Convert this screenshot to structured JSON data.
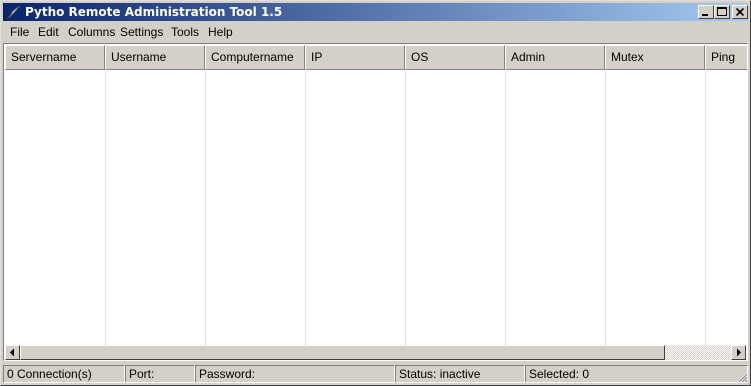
{
  "window": {
    "title": "Pytho Remote Administration Tool 1.5"
  },
  "menu": [
    "File",
    "Edit",
    "Columns",
    "Settings",
    "Tools",
    "Help"
  ],
  "columns": [
    "Servername",
    "Username",
    "Computername",
    "IP",
    "OS",
    "Admin",
    "Mutex",
    "Ping"
  ],
  "status": {
    "connections": "0 Connection(s)",
    "port": "Port:",
    "password": "Password:",
    "status": "Status: inactive",
    "selected": "Selected: 0"
  }
}
